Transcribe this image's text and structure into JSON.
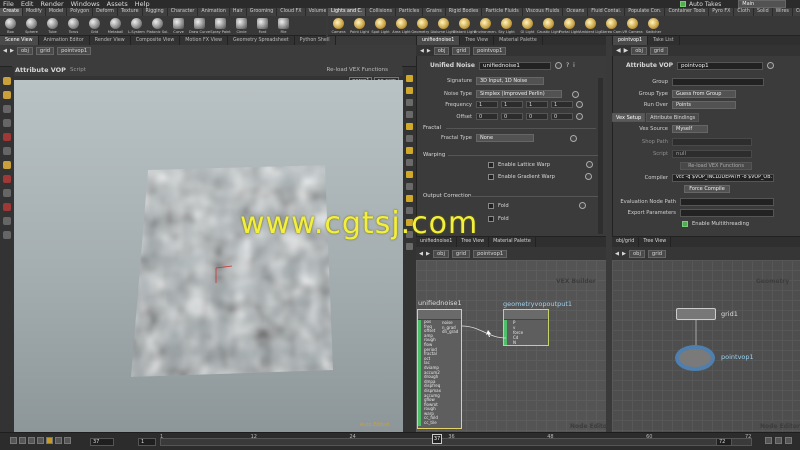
{
  "menubar": {
    "items": [
      "File",
      "Edit",
      "Render",
      "Windows",
      "Assets",
      "Help"
    ],
    "auto_takes": "Auto Takes",
    "main": "Main"
  },
  "shelf_left": {
    "tabs": [
      "Create",
      "Modify",
      "Model",
      "Polygon",
      "Deform",
      "Texture",
      "Rigging",
      "Character",
      "Animation",
      "Hair",
      "Grooming",
      "Cloud FX",
      "Volume"
    ],
    "tools": [
      "Box",
      "Sphere",
      "Tube",
      "Torus",
      "Grid",
      "Metaball",
      "L-System",
      "Platonic Sol.",
      "Curve",
      "Draw Curve",
      "Spray Paint",
      "Circle",
      "Font",
      "File"
    ]
  },
  "shelf_right": {
    "tabs": [
      "Lights and C.",
      "Collisions",
      "Particles",
      "Grains",
      "Rigid Bodies",
      "Particle Fluids",
      "Viscous Fluids",
      "Oceans",
      "Fluid Contai.",
      "Populate Con.",
      "Container Tools",
      "Pyro FX",
      "Cloth",
      "Solid",
      "Wires",
      "Crowds",
      "Drive Simula."
    ],
    "tools": [
      "Camera",
      "Point Light",
      "Spot Light",
      "Area Light",
      "Geometry L.",
      "Volume Light",
      "Distant Light",
      "Environmen.",
      "Sky Light",
      "GI Light",
      "Caustic Light",
      "Portal Light",
      "Ambient Lig.",
      "Stereo Cam.",
      "VR Camera",
      "Switcher"
    ]
  },
  "pane_tabs_left": [
    "Scene View",
    "Animation Editor",
    "Render View",
    "Composite View",
    "Motion FX View",
    "Geometry Spreadsheet",
    "Python Shell"
  ],
  "viewport": {
    "title": "Attribute VOP",
    "mode": "Script",
    "path_obj": "obj",
    "path_node": "grid",
    "path_vop": "pointvop1",
    "reload": "Re-load VEX Functions",
    "persp": "persp1",
    "cam": "no cam",
    "auto_edit": "Auto Edited"
  },
  "param_noise": {
    "tabs": [
      "unifiednoise1",
      "Tree View",
      "Material Palette"
    ],
    "path_obj": "obj",
    "path_grid": "grid",
    "path_vop": "pointvop1",
    "type_label": "Unified Noise",
    "node_name": "unifiednoise1",
    "signature_label": "Signature",
    "signature_value": "3D Input, 1D Noise",
    "noise_type_label": "Noise Type",
    "noise_type_value": "Simplex (Improved Perlin)",
    "frequency_label": "Frequency",
    "frequency": [
      "1",
      "1",
      "1",
      "1"
    ],
    "offset_label": "Offset",
    "offset": [
      "0",
      "0",
      "0",
      "0"
    ],
    "fractal_section": "Fractal",
    "fractal_type_label": "Fractal Type",
    "fractal_type_value": "None",
    "warping_section": "Warping",
    "lattice_warp": "Enable Lattice Warp",
    "gradient_warp": "Enable Gradient Warp",
    "output_section": "Output Correction",
    "fold": "Fold",
    "fold2": "Fold"
  },
  "param_vop": {
    "tabs": [
      "pointvop1",
      "Take List"
    ],
    "path_obj": "obj",
    "path_grid": "grid",
    "type_label": "Attribute VOP",
    "node_name": "pointvop1",
    "group_label": "Group",
    "group_type_label": "Group Type",
    "group_type_value": "Guess from Group",
    "run_over_label": "Run Over",
    "run_over_value": "Points",
    "tabs2": [
      "Vex Setup",
      "Attribute Bindings"
    ],
    "vex_source_label": "Vex Source",
    "vex_source_value": "Myself",
    "shop_path_label": "Shop Path",
    "script_label": "Script",
    "script_value": "null",
    "reload": "Re-load VEX Functions",
    "compiler_label": "Compiler",
    "compiler_value": "vcc -q $VOP_INCLUDEPATH -o $VOP_OB.",
    "force_compile": "Force Compile",
    "eval_path_label": "Evaluation Node Path",
    "export_label": "Export Parameters",
    "multithread": "Enable Multithreading"
  },
  "net_left": {
    "tabs": [
      "unifiednoise1",
      "Tree View",
      "Material Palette"
    ],
    "path_obj": "obj",
    "path_grid": "grid",
    "path_vop": "pointvop1",
    "watermark": "VEX Builder",
    "watermark_bottom": "Node Editor",
    "node1_name": "unifiednoise1",
    "node2_name": "geometryvopoutput1",
    "node1_ports": [
      "pos",
      "freq",
      "offset",
      "amp",
      "rough",
      "flow",
      "period",
      "fractal",
      "oct",
      "lac",
      "dviamp",
      "accum2",
      "drough",
      "dmpa",
      "dispfreq",
      "dispmax",
      "accumg",
      "gflow",
      "flowrot",
      "rough",
      "warp",
      "cc_fold",
      "cc_tile"
    ],
    "node1_outputs": [
      "noise",
      "n_grad",
      "dn_grad"
    ],
    "node2_ports": [
      "P",
      "v",
      "force",
      "Cd",
      "N"
    ]
  },
  "net_right": {
    "tabs": [
      "obj/grid",
      "Tree View"
    ],
    "path_obj": "obj",
    "path_grid": "grid",
    "watermark": "Geometry",
    "watermark_bottom": "Node Editor",
    "node_grid": "grid1",
    "node_vop": "pointvop1"
  },
  "timeline": {
    "current": "37",
    "start": "1",
    "end": "72",
    "end2": "72",
    "ticks": [
      "1",
      "12",
      "24",
      "36",
      "48",
      "60",
      "72"
    ],
    "frame_field": "37",
    "step_field": "1"
  },
  "watermark_text": "www.cgtsj.com"
}
